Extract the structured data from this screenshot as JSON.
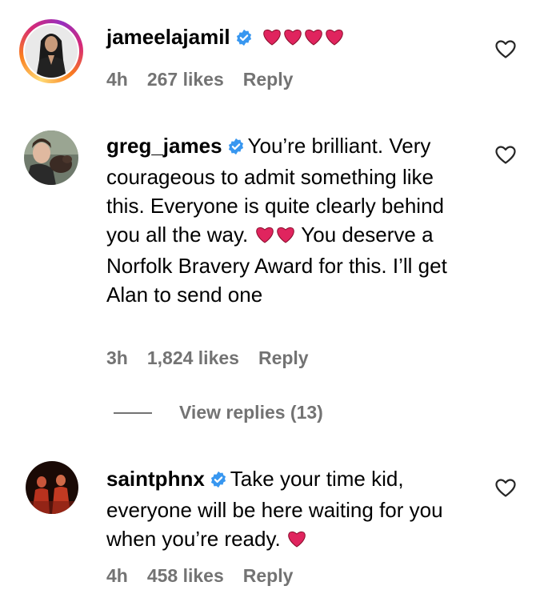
{
  "comments": [
    {
      "username": "jameelajamil",
      "verified": true,
      "text": "",
      "hearts": 4,
      "time": "4h",
      "likes": "267 likes",
      "reply_label": "Reply"
    },
    {
      "username": "greg_james",
      "verified": true,
      "text_part1": "You’re brilliant. Very courageous to admit something like this. Everyone is quite clearly behind you all the way.",
      "hearts": 2,
      "text_part2": "You deserve a Norfolk Bravery Award for this. I’ll get Alan to send one",
      "time": "3h",
      "likes": "1,824 likes",
      "reply_label": "Reply"
    },
    {
      "username": "saintphnx",
      "verified": true,
      "text_part1": "Take your time kid, everyone will be here waiting for you when you’re ready.",
      "hearts": 1,
      "time": "4h",
      "likes": "458 likes",
      "reply_label": "Reply"
    }
  ],
  "view_replies_label": "View replies (13)",
  "colors": {
    "verified": "#3897f0",
    "heart": "#e0245e",
    "meta_text": "#737373"
  },
  "icons": [
    "verified-badge-icon",
    "heart-emoji-icon",
    "like-heart-outline-icon"
  ]
}
